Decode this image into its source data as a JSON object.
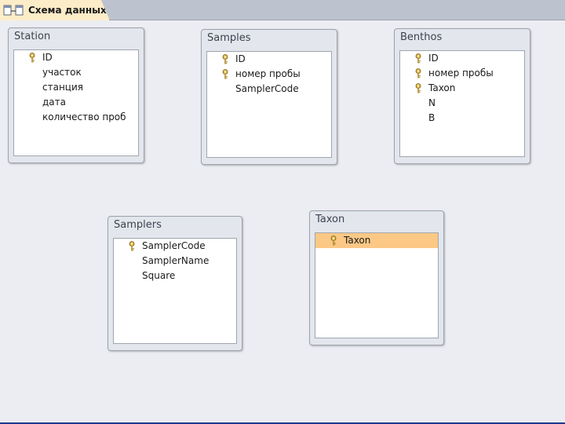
{
  "tab": {
    "label": "Схема данных"
  },
  "tables": [
    {
      "id": "station",
      "title": "Station",
      "fields": [
        {
          "name": "ID",
          "key": true
        },
        {
          "name": "участок",
          "key": false
        },
        {
          "name": "станция",
          "key": false
        },
        {
          "name": "дата",
          "key": false
        },
        {
          "name": "количество проб",
          "key": false
        }
      ]
    },
    {
      "id": "samples",
      "title": "Samples",
      "fields": [
        {
          "name": "ID",
          "key": true
        },
        {
          "name": "номер пробы",
          "key": true
        },
        {
          "name": "SamplerCode",
          "key": false
        }
      ]
    },
    {
      "id": "benthos",
      "title": "Benthos",
      "fields": [
        {
          "name": "ID",
          "key": true
        },
        {
          "name": "номер пробы",
          "key": true
        },
        {
          "name": "Taxon",
          "key": true
        },
        {
          "name": "N",
          "key": false
        },
        {
          "name": "B",
          "key": false
        }
      ]
    },
    {
      "id": "samplers",
      "title": "Samplers",
      "fields": [
        {
          "name": "SamplerCode",
          "key": true
        },
        {
          "name": "SamplerName",
          "key": false
        },
        {
          "name": "Square",
          "key": false
        }
      ]
    },
    {
      "id": "taxon",
      "title": "Taxon",
      "fields": [
        {
          "name": "Taxon",
          "key": true,
          "selected": true
        }
      ]
    }
  ],
  "colors": {
    "selected_row": "#fbc886",
    "tab": "#fcecc8"
  }
}
